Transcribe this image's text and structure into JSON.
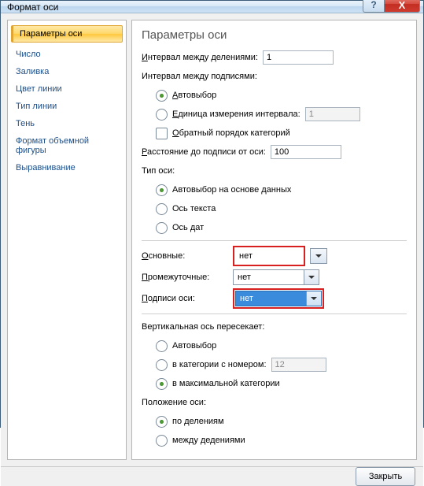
{
  "window": {
    "title": "Формат оси"
  },
  "titlebar": {
    "help": "?",
    "close": "X"
  },
  "sidebar": {
    "items": [
      "Параметры оси",
      "Число",
      "Заливка",
      "Цвет линии",
      "Тип линии",
      "Тень",
      "Формат объемной фигуры",
      "Выравнивание"
    ],
    "selected_index": 0
  },
  "main": {
    "heading": "Параметры оси",
    "interval_div": {
      "label_pre": "И",
      "label_rest": "нтервал между делениями:",
      "value": "1"
    },
    "interval_sig_label": "Интервал между подписями:",
    "interval_sig": {
      "auto": {
        "pre": "А",
        "rest": "втовыбор"
      },
      "unit": {
        "pre": "Е",
        "rest": "диница измерения интервала:",
        "value": "1"
      }
    },
    "reverse": {
      "pre": "О",
      "rest": "братный порядок категорий"
    },
    "dist": {
      "pre": "Р",
      "rest": "асстояние до подписи от оси:",
      "value": "100"
    },
    "axis_type": {
      "label": "Тип оси:",
      "auto": "Автовыбор на основе данных",
      "text": "Ось текста",
      "date": "Ось дат"
    },
    "ticks": {
      "major": {
        "label_pre": "О",
        "label_rest": "сновные:",
        "value": "нет"
      },
      "minor": {
        "label_pre": "П",
        "label_rest": "ромежуточные:",
        "value": "нет"
      },
      "labels": {
        "label_pre": "П",
        "label_rest": "одписи оси:",
        "value": "нет"
      }
    },
    "vaxis": {
      "label": "Вертикальная ось пересекает:",
      "auto": "Автовыбор",
      "cat": {
        "label": "в категории с номером:",
        "value": "12"
      },
      "max": "в максимальной категории"
    },
    "pos": {
      "label": "Положение оси:",
      "bydiv": "по делениям",
      "between": "между дедениями"
    }
  },
  "footer": {
    "close_label": "Закрыть"
  }
}
